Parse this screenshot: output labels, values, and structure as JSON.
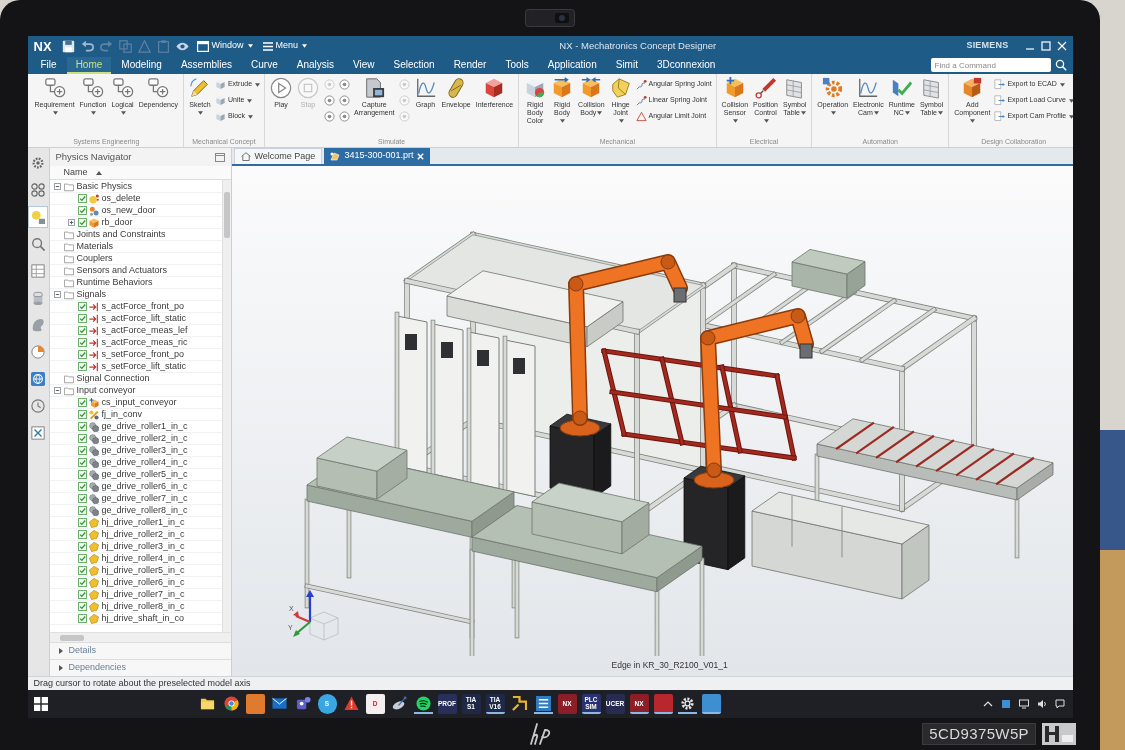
{
  "window": {
    "logo": "NX",
    "menus": [
      {
        "kind": "window",
        "label": "Window",
        "dropdown": true
      },
      {
        "kind": "menu",
        "label": "Menu",
        "dropdown": true
      }
    ],
    "title": "NX - Mechatronics Concept Designer",
    "brand": "SIEMENS",
    "search": {
      "placeholder": "Find a Command"
    }
  },
  "ribbon_tabs": [
    {
      "label": "File",
      "selected": false
    },
    {
      "label": "Home",
      "selected": true
    },
    {
      "label": "Modeling",
      "selected": false
    },
    {
      "label": "Assemblies",
      "selected": false
    },
    {
      "label": "Curve",
      "selected": false
    },
    {
      "label": "Analysis",
      "selected": false
    },
    {
      "label": "View",
      "selected": false
    },
    {
      "label": "Selection",
      "selected": false
    },
    {
      "label": "Render",
      "selected": false
    },
    {
      "label": "Tools",
      "selected": false
    },
    {
      "label": "Application",
      "selected": false
    },
    {
      "label": "Simit",
      "selected": false
    },
    {
      "label": "3Dconnexion",
      "selected": false
    }
  ],
  "ribbon": [
    {
      "title": "Systems Engineering",
      "items": [
        {
          "kind": "large",
          "label": "Requirement",
          "dropdown": true
        },
        {
          "kind": "large",
          "label": "Function",
          "dropdown": true
        },
        {
          "kind": "large",
          "label": "Logical",
          "dropdown": true
        },
        {
          "kind": "large",
          "label": "Dependency",
          "dropdown": false
        }
      ]
    },
    {
      "title": "Mechanical Concept",
      "items": [
        {
          "kind": "large",
          "label": "Sketch",
          "dropdown": true
        },
        {
          "kind": "small",
          "label": "Extrude",
          "dropdown": true
        },
        {
          "kind": "small",
          "label": "Unite",
          "dropdown": true
        },
        {
          "kind": "small",
          "label": "Block",
          "dropdown": true
        }
      ]
    },
    {
      "title": "Simulate",
      "items": [
        {
          "kind": "large",
          "label": "Play",
          "dropdown": false,
          "disabled": false
        },
        {
          "kind": "large",
          "label": "Stop",
          "dropdown": false,
          "disabled": true
        },
        {
          "kind": "mini",
          "disabled": true
        },
        {
          "kind": "mini",
          "disabled": false
        },
        {
          "kind": "mini",
          "disabled": false
        },
        {
          "kind": "mini",
          "disabled": false
        },
        {
          "kind": "mini",
          "disabled": false
        },
        {
          "kind": "mini",
          "disabled": false
        },
        {
          "kind": "large",
          "label": "Capture Arrangement",
          "dropdown": false,
          "disabled": false
        },
        {
          "kind": "mini",
          "disabled": true
        },
        {
          "kind": "mini",
          "disabled": true
        },
        {
          "kind": "mini",
          "disabled": true
        },
        {
          "kind": "large",
          "label": "Graph",
          "dropdown": false,
          "disabled": false
        },
        {
          "kind": "large",
          "label": "Envelope",
          "dropdown": false,
          "disabled": false
        },
        {
          "kind": "large",
          "label": "Interference",
          "dropdown": false,
          "disabled": false
        }
      ]
    },
    {
      "title": "Mechanical",
      "items": [
        {
          "kind": "large",
          "label": "Rigid Body Color",
          "dropdown": false
        },
        {
          "kind": "large",
          "label": "Rigid Body",
          "dropdown": true
        },
        {
          "kind": "large",
          "label": "Collision Body",
          "dropdown": true
        },
        {
          "kind": "large",
          "label": "Hinge Joint",
          "dropdown": true
        },
        {
          "kind": "small",
          "label": "Angular Spring Joint",
          "dropdown": false
        },
        {
          "kind": "small",
          "label": "Linear Spring Joint",
          "dropdown": false
        },
        {
          "kind": "small",
          "label": "Angular Limit Joint",
          "dropdown": false
        }
      ]
    },
    {
      "title": "Electrical",
      "items": [
        {
          "kind": "large",
          "label": "Collision Sensor",
          "dropdown": true
        },
        {
          "kind": "large",
          "label": "Position Control",
          "dropdown": true
        },
        {
          "kind": "large",
          "label": "Symbol Table",
          "dropdown": true
        }
      ]
    },
    {
      "title": "Automation",
      "items": [
        {
          "kind": "large",
          "label": "Operation",
          "dropdown": true
        },
        {
          "kind": "large",
          "label": "Electronic Cam",
          "dropdown": true
        },
        {
          "kind": "large",
          "label": "Runtime NC",
          "dropdown": true
        },
        {
          "kind": "large",
          "label": "Symbol Table",
          "dropdown": true
        }
      ]
    },
    {
      "title": "Design Collaboration",
      "items": [
        {
          "kind": "large",
          "label": "Add Component",
          "dropdown": true
        },
        {
          "kind": "small",
          "label": "Export to ECAD",
          "dropdown": true
        },
        {
          "kind": "small",
          "label": "Export Load Curve",
          "dropdown": true
        },
        {
          "kind": "small",
          "label": "Export Cam Profile",
          "dropdown": true
        }
      ]
    }
  ],
  "resource_bar": [
    {
      "selected": false
    },
    {
      "selected": false
    },
    {
      "selected": true
    },
    {
      "selected": false
    },
    {
      "selected": false
    },
    {
      "selected": false
    },
    {
      "selected": false
    },
    {
      "selected": false
    },
    {
      "selected": false
    },
    {
      "selected": false
    },
    {
      "selected": false
    }
  ],
  "navigator": {
    "title": "Physics Navigator",
    "column": "Name",
    "tree": [
      {
        "label": "Basic Physics",
        "kind": "folder",
        "expanded": true,
        "children": [
          {
            "label": "os_delete",
            "kind": "sink",
            "checked": true
          },
          {
            "label": "os_new_door",
            "kind": "source",
            "checked": true
          },
          {
            "label": "rb_door",
            "kind": "rigid_body",
            "checked": true,
            "expanded": false
          }
        ]
      },
      {
        "label": "Joints and Constraints",
        "kind": "folder"
      },
      {
        "label": "Materials",
        "kind": "folder"
      },
      {
        "label": "Couplers",
        "kind": "folder"
      },
      {
        "label": "Sensors and Actuators",
        "kind": "folder"
      },
      {
        "label": "Runtime Behaviors",
        "kind": "folder"
      },
      {
        "label": "Signals",
        "kind": "folder",
        "expanded": true,
        "children": [
          {
            "label": "s_actForce_front_po",
            "kind": "signal",
            "checked": true
          },
          {
            "label": "s_actForce_lift_static",
            "kind": "signal",
            "checked": true
          },
          {
            "label": "s_actForce_meas_lef",
            "kind": "signal",
            "checked": true
          },
          {
            "label": "s_actForce_meas_ric",
            "kind": "signal",
            "checked": true
          },
          {
            "label": "s_setForce_front_po",
            "kind": "signal",
            "checked": true
          },
          {
            "label": "s_setForce_lift_static",
            "kind": "signal",
            "checked": true
          }
        ]
      },
      {
        "label": "Signal Connection",
        "kind": "folder"
      },
      {
        "label": "Input conveyor",
        "kind": "folder",
        "expanded": true,
        "children": [
          {
            "label": "cs_input_conveyor",
            "kind": "collision_sensor",
            "checked": true
          },
          {
            "label": "fj_in_conv",
            "kind": "fixed_joint",
            "checked": true
          },
          {
            "label": "ge_drive_roller1_in_c",
            "kind": "gear",
            "checked": true
          },
          {
            "label": "ge_drive_roller2_in_c",
            "kind": "gear",
            "checked": true
          },
          {
            "label": "ge_drive_roller3_in_c",
            "kind": "gear",
            "checked": true
          },
          {
            "label": "ge_drive_roller4_in_c",
            "kind": "gear",
            "checked": true
          },
          {
            "label": "ge_drive_roller5_in_c",
            "kind": "gear",
            "checked": true
          },
          {
            "label": "ge_drive_roller6_in_c",
            "kind": "gear",
            "checked": true
          },
          {
            "label": "ge_drive_roller7_in_c",
            "kind": "gear",
            "checked": true
          },
          {
            "label": "ge_drive_roller8_in_c",
            "kind": "gear",
            "checked": true
          },
          {
            "label": "hj_drive_roller1_in_c",
            "kind": "hinge_joint",
            "checked": true
          },
          {
            "label": "hj_drive_roller2_in_c",
            "kind": "hinge_joint",
            "checked": true
          },
          {
            "label": "hj_drive_roller3_in_c",
            "kind": "hinge_joint",
            "checked": true
          },
          {
            "label": "hj_drive_roller4_in_c",
            "kind": "hinge_joint",
            "checked": true
          },
          {
            "label": "hj_drive_roller5_in_c",
            "kind": "hinge_joint",
            "checked": true
          },
          {
            "label": "hj_drive_roller6_in_c",
            "kind": "hinge_joint",
            "checked": true
          },
          {
            "label": "hj_drive_roller7_in_c",
            "kind": "hinge_joint",
            "checked": true
          },
          {
            "label": "hj_drive_roller8_in_c",
            "kind": "hinge_joint",
            "checked": true
          },
          {
            "label": "hj_drive_shaft_in_co",
            "kind": "hinge_joint",
            "checked": true
          }
        ]
      }
    ],
    "sections": [
      {
        "label": "Details",
        "expanded": false
      },
      {
        "label": "Dependencies",
        "expanded": false
      }
    ]
  },
  "document_tabs": [
    {
      "kind": "home",
      "label": "Welcome Page",
      "selected": false,
      "closable": false
    },
    {
      "kind": "part",
      "label": "3415-300-001.prt",
      "selected": true,
      "closable": true
    }
  ],
  "viewport": {
    "axis_labels": [
      "X",
      "Y"
    ],
    "status": "Edge in KR_30_R2100_V01_1"
  },
  "status_bar": {
    "message": "Drag cursor to rotate about the preselected model axis"
  },
  "taskbar": {
    "apps": [
      {
        "kind": "folder",
        "running": false
      },
      {
        "kind": "browser",
        "running": false
      },
      {
        "kind": "tile",
        "color": "#e07a2e",
        "running": false
      },
      {
        "kind": "mail",
        "running": false
      },
      {
        "kind": "chat",
        "running": false
      },
      {
        "kind": "round",
        "label": "S",
        "color": "#3aa6e2",
        "running": false
      },
      {
        "kind": "warning",
        "running": false
      },
      {
        "kind": "tile",
        "label": "D",
        "color": "#f4eeee",
        "running": false
      },
      {
        "kind": "dish",
        "running": false
      },
      {
        "kind": "music",
        "running": true
      },
      {
        "kind": "tile",
        "label": "PROF",
        "color": "#28305a",
        "running": false
      },
      {
        "kind": "tile",
        "label": "TIA S1",
        "color": "#1f2947",
        "running": false
      },
      {
        "kind": "tile",
        "label": "TIA V16",
        "color": "#1f2947",
        "running": true
      },
      {
        "kind": "arrows",
        "running": false
      },
      {
        "kind": "portal",
        "running": true
      },
      {
        "kind": "tile",
        "label": "NX",
        "color": "#8c1e28",
        "running": false
      },
      {
        "kind": "tile",
        "label": "PLC SIM",
        "color": "#27326e",
        "running": true
      },
      {
        "kind": "tile",
        "label": "UCER",
        "color": "#262b52",
        "running": false
      },
      {
        "kind": "tile",
        "label": "NX",
        "color": "#8c1e28",
        "running": true
      },
      {
        "kind": "tile",
        "color": "#b8262e",
        "running": true
      },
      {
        "kind": "settings",
        "running": true
      },
      {
        "kind": "tile",
        "color": "#3d8fd1",
        "running": true
      }
    ]
  },
  "laptop": {
    "serial": "5CD9375W5P"
  }
}
